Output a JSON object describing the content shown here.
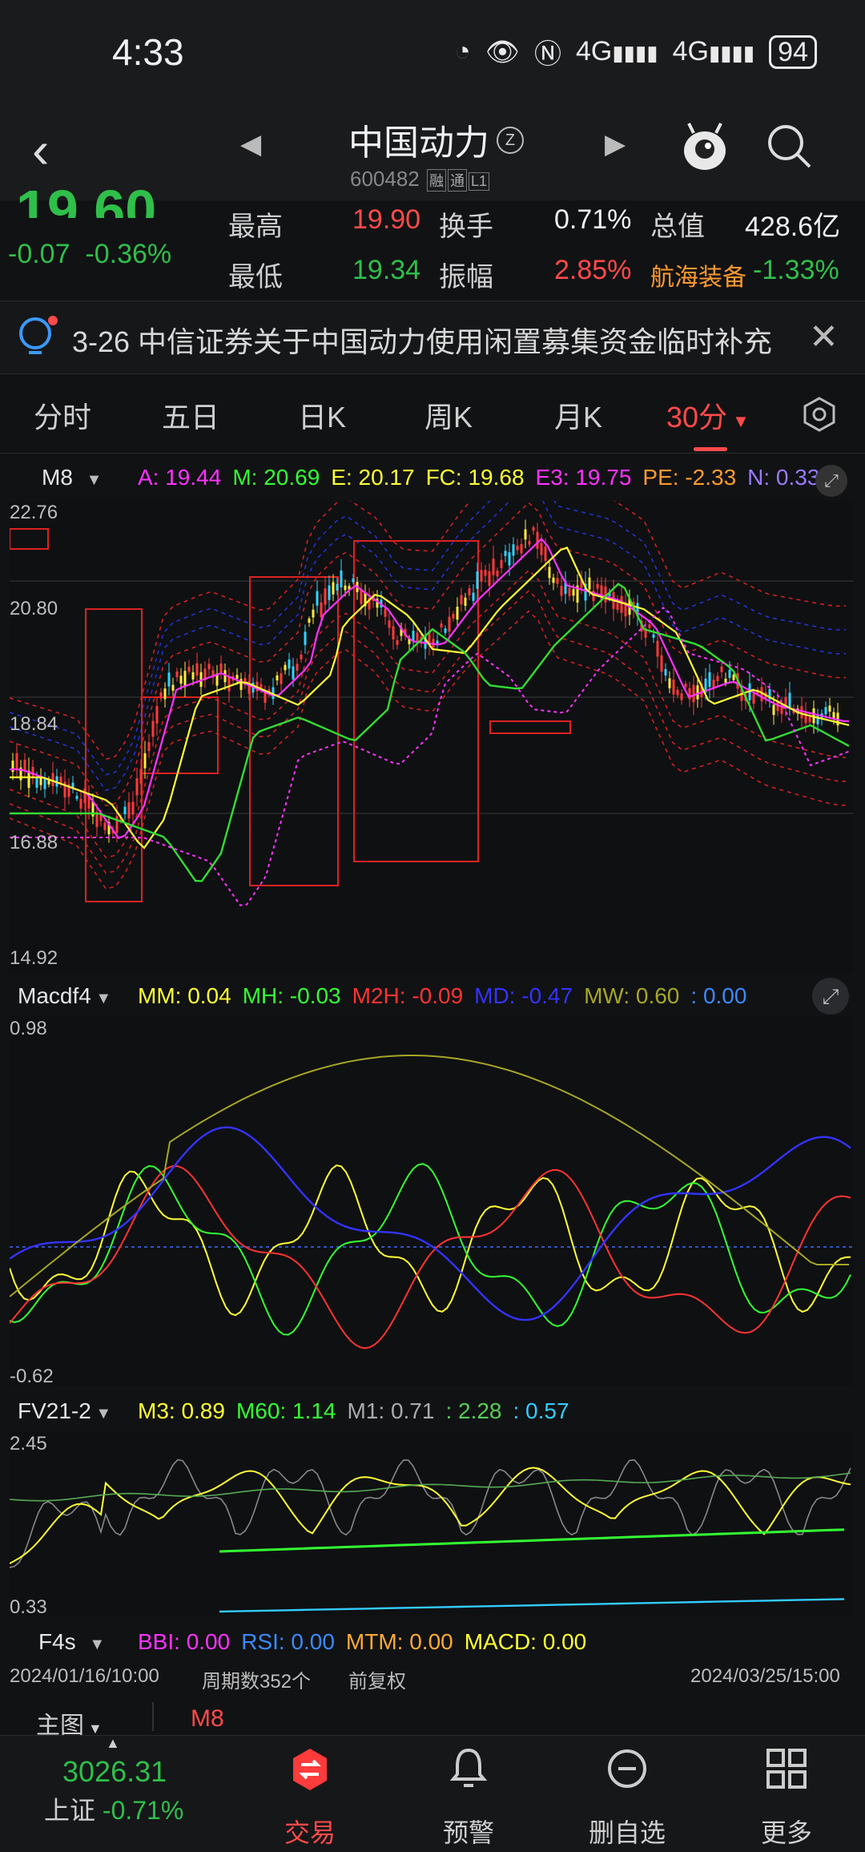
{
  "status": {
    "time": "4:33",
    "battery": "94",
    "net1": "4G",
    "net2": "4G"
  },
  "header": {
    "title": "中国动力",
    "title_badge": "Z",
    "code": "600482",
    "code_badges": [
      "融",
      "通",
      "L1"
    ]
  },
  "quote": {
    "price_partial": "19.60",
    "change": "-0.07",
    "change_pct": "-0.36%",
    "high_label": "最高",
    "high": "19.90",
    "low_label": "最低",
    "low": "19.34",
    "turnover_label": "换手",
    "turnover": "0.71%",
    "amplitude_label": "振幅",
    "amplitude": "2.85%",
    "mcap_label": "总值",
    "mcap": "428.6亿",
    "sector_label": "航海装备",
    "sector_chg": "-1.33%"
  },
  "notice": {
    "text": "3-26 中信证券关于中国动力使用闲置募集资金临时补充"
  },
  "tabs": [
    "分时",
    "五日",
    "日K",
    "周K",
    "月K",
    "30分"
  ],
  "main_legend": {
    "name": "M8",
    "items": [
      {
        "t": "A: 19.44",
        "c": "#ff33ff"
      },
      {
        "t": "M: 20.69",
        "c": "#33ff33"
      },
      {
        "t": "E: 20.17",
        "c": "#ffff33"
      },
      {
        "t": "FC: 19.68",
        "c": "#ffff33"
      },
      {
        "t": "E3: 19.75",
        "c": "#ff33ff"
      },
      {
        "t": "PE: -2.33",
        "c": "#ff9a2e"
      },
      {
        "t": "N: 0.33",
        "c": "#9a7aff"
      }
    ],
    "y_labels": [
      "22.76",
      "20.80",
      "18.84",
      "16.88",
      "14.92"
    ]
  },
  "macd_legend": {
    "name": "Macdf4",
    "items": [
      {
        "t": "MM: 0.04",
        "c": "#ffff33"
      },
      {
        "t": "MH: -0.03",
        "c": "#33ff33"
      },
      {
        "t": "M2H: -0.09",
        "c": "#ff3333"
      },
      {
        "t": "MD: -0.47",
        "c": "#3333ff"
      },
      {
        "t": "MW: 0.60",
        "c": "#a6a626"
      },
      {
        "t": ": 0.00",
        "c": "#3a8aff"
      }
    ],
    "y_top": "0.98",
    "y_bottom": "-0.62"
  },
  "fv_legend": {
    "name": "FV21-2",
    "items": [
      {
        "t": "M3: 0.89",
        "c": "#ffff33"
      },
      {
        "t": "M60: 1.14",
        "c": "#33ff33"
      },
      {
        "t": "M1: 0.71",
        "c": "#aaaaaa"
      },
      {
        "t": ": 2.28",
        "c": "#55cc55"
      },
      {
        "t": ": 0.57",
        "c": "#33ccff"
      }
    ],
    "y_top": "2.45",
    "y_bottom": "0.33"
  },
  "f4s_legend": {
    "name": "F4s",
    "items": [
      {
        "t": "BBI: 0.00",
        "c": "#ff33ff"
      },
      {
        "t": "RSI: 0.00",
        "c": "#3a8aff"
      },
      {
        "t": "MTM: 0.00",
        "c": "#ffaa33"
      },
      {
        "t": "MACD: 0.00",
        "c": "#ffff33"
      }
    ]
  },
  "footer_info": {
    "start": "2024/01/16/10:00",
    "periods": "周期数352个",
    "adjust": "前复权",
    "end": "2024/03/25/15:00"
  },
  "subtabs": {
    "main": "主图",
    "indicator": "M8"
  },
  "index": {
    "value": "3026.31",
    "name": "上证",
    "chg": "-0.71%"
  },
  "nav": [
    "交易",
    "预警",
    "删自选",
    "更多"
  ]
}
